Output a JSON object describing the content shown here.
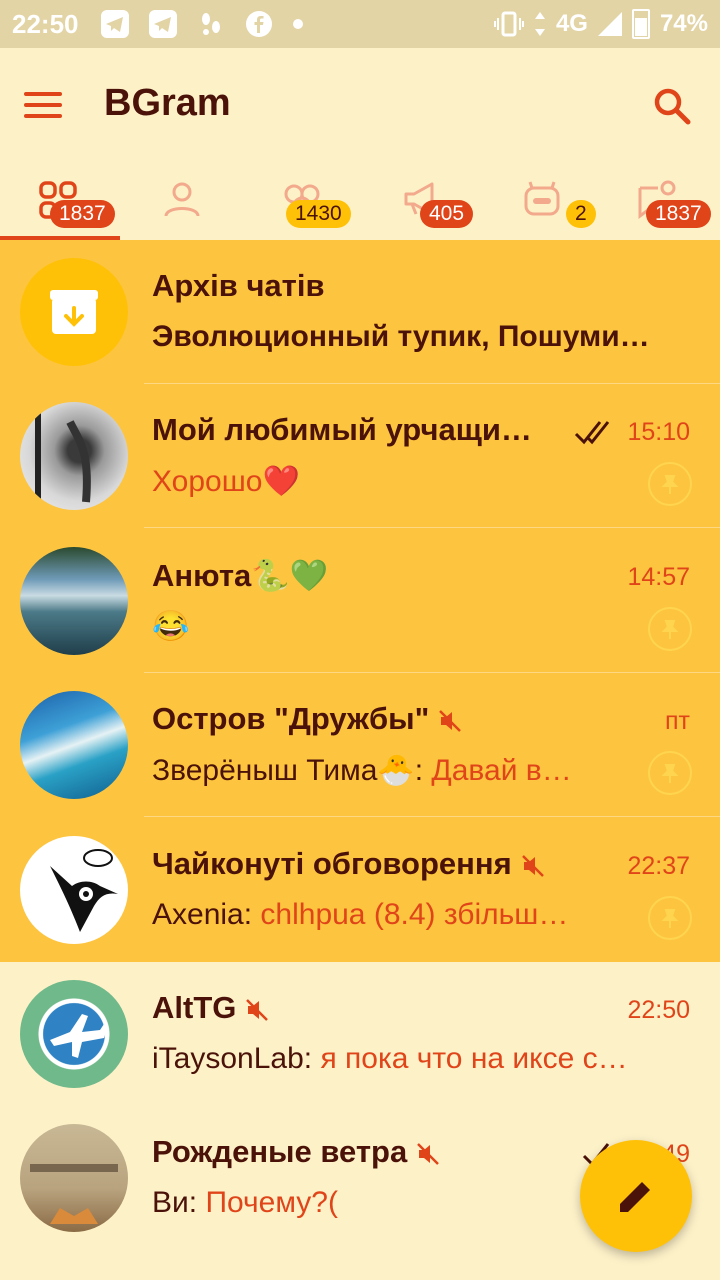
{
  "status_bar": {
    "time": "22:50",
    "network": "4G",
    "battery": "74%",
    "icons": [
      "telegram-icon",
      "telegram-icon",
      "footsteps-icon",
      "facebook-icon",
      "dot-icon",
      "vibrate-icon",
      "signal-icon",
      "battery-icon"
    ]
  },
  "header": {
    "title": "BGram",
    "menu_icon": "menu-icon",
    "search_icon": "search-icon"
  },
  "tabs": [
    {
      "icon": "all-chats-icon",
      "badge": "1837",
      "badge_color": "#e0451a",
      "selected": true
    },
    {
      "icon": "person-icon",
      "badge": "",
      "badge_color": "",
      "selected": false
    },
    {
      "icon": "group-icon",
      "badge": "1430",
      "badge_color": "#ffc107",
      "selected": false
    },
    {
      "icon": "megaphone-icon",
      "badge": "405",
      "badge_color": "#e0451a",
      "selected": false
    },
    {
      "icon": "bot-icon",
      "badge": "2",
      "badge_color": "#ffc107",
      "selected": false
    },
    {
      "icon": "unread-icon",
      "badge": "1837",
      "badge_color": "#e0451a",
      "selected": false
    }
  ],
  "chats": [
    {
      "name": "Архів чатів",
      "preview": "Эволюционный тупик, Пошуми…",
      "time": "",
      "archive": true
    },
    {
      "name": "Мой любимый урчащи…",
      "sender": "",
      "preview": "Хорошо❤️",
      "time": "15:10",
      "read": "double-check",
      "pinned": true
    },
    {
      "name": "Анюта🐍💚",
      "sender": "",
      "preview": "😂",
      "time": "14:57",
      "pinned": true
    },
    {
      "name": "Остров \"Дружбы\"",
      "muted": true,
      "sender": "Зверёныш Тима🐣: ",
      "preview": "Давай в…",
      "time": "пт",
      "pinned": true
    },
    {
      "name": "Чайконуті обговорення",
      "muted": true,
      "sender": "Axenia: ",
      "preview": "chlhpua (8.4) збільш…",
      "time": "22:37",
      "pinned": true
    },
    {
      "name": "AltTG",
      "muted": true,
      "sender": "iTaysonLab: ",
      "preview": "я пока что на иксе с…",
      "time": "22:50",
      "pinned": false
    },
    {
      "name": "Рожденые ветра",
      "muted": true,
      "sender": "Ви: ",
      "preview": "Почему?(",
      "time": "49",
      "read": "check",
      "pinned": false
    }
  ],
  "colors": {
    "accent": "#e0451a",
    "pinned_bg": "#fdc43f",
    "bg": "#fdf1c8",
    "fab": "#ffc107"
  },
  "fab_icon": "pencil-icon"
}
